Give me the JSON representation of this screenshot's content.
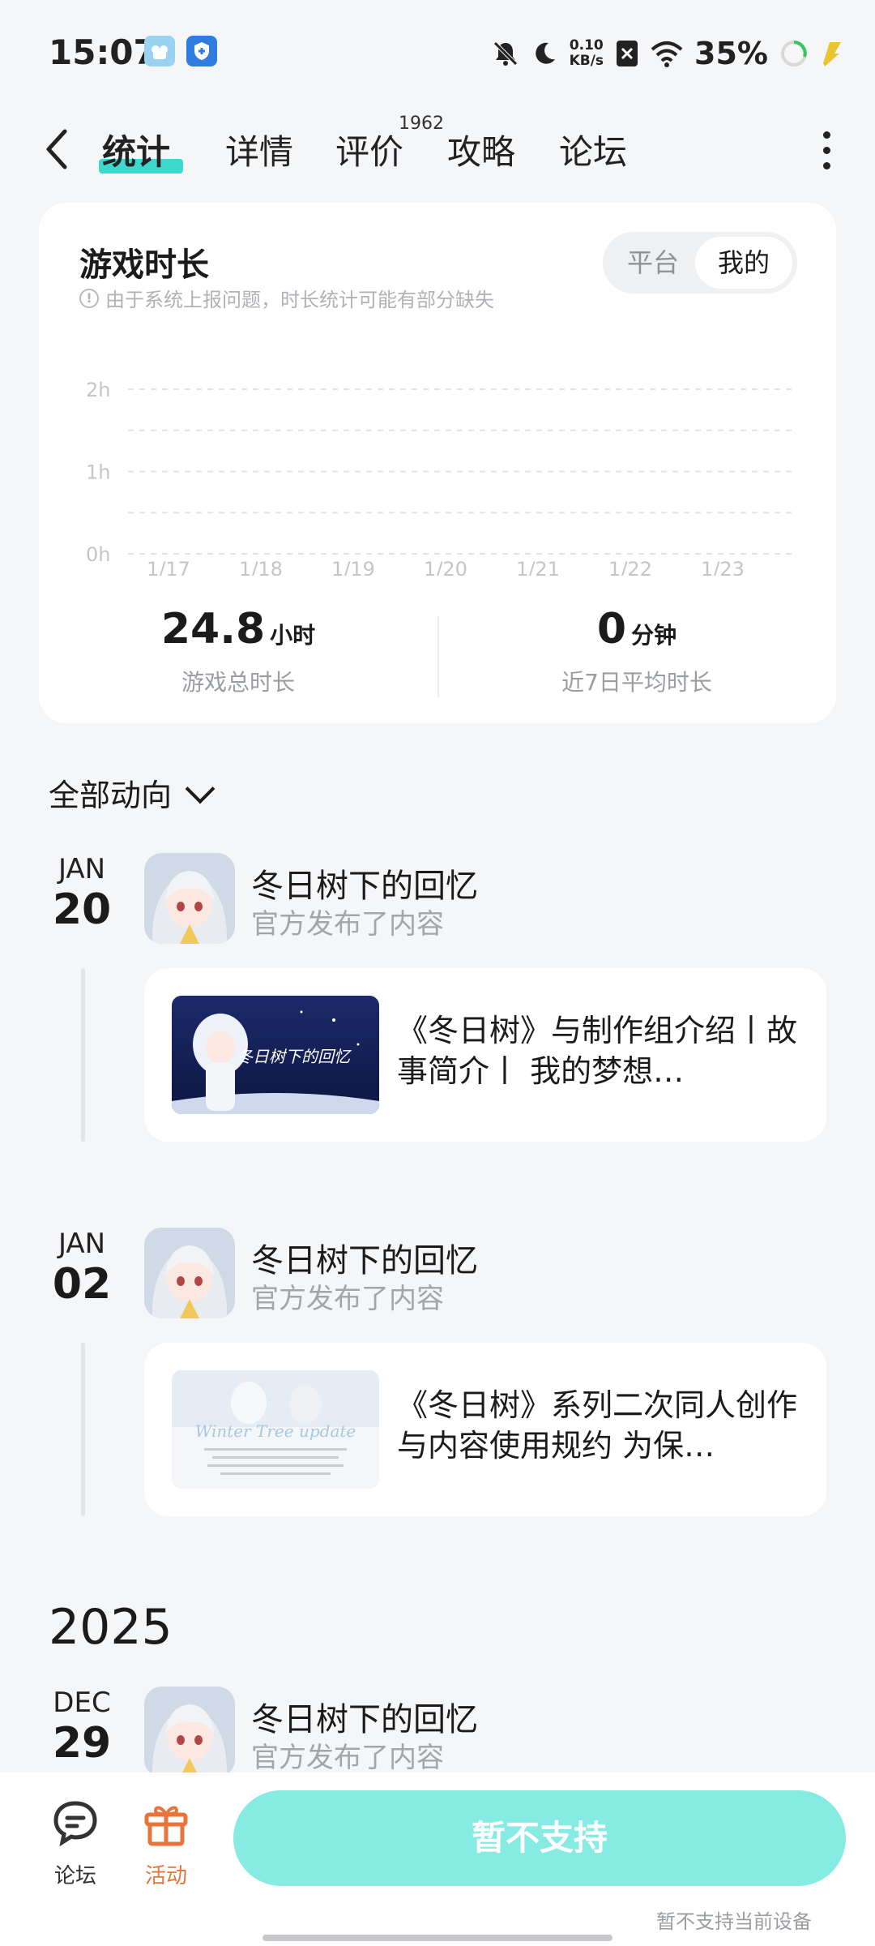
{
  "status_bar": {
    "time": "15:07",
    "net_speed_value": "0.10",
    "net_speed_unit": "KB/s",
    "battery": "35%",
    "icons": [
      "app-icon",
      "shield-icon",
      "bell-off-icon",
      "moon-icon",
      "sim-off-icon",
      "wifi-icon",
      "battery-ring-icon",
      "charging-icon"
    ]
  },
  "tabs": {
    "items": [
      "统计",
      "详情",
      "评价",
      "攻略",
      "论坛"
    ],
    "active": "统计",
    "review_count": "1962"
  },
  "stats_card": {
    "title": "游戏时长",
    "note": "由于系统上报问题，时长统计可能有部分缺失",
    "toggle": {
      "option_platform": "平台",
      "option_mine": "我的",
      "selected": "我的"
    },
    "total_value": "24.8",
    "total_unit": "小时",
    "total_label": "游戏总时长",
    "avg_value": "0",
    "avg_unit": "分钟",
    "avg_label": "近7日平均时长"
  },
  "chart_data": {
    "type": "bar",
    "categories": [
      "1/17",
      "1/18",
      "1/19",
      "1/20",
      "1/21",
      "1/22",
      "1/23"
    ],
    "values": [
      0,
      0,
      0,
      0,
      0,
      0,
      0
    ],
    "y_ticks": [
      "2h",
      "1h",
      "0h"
    ],
    "ylim": [
      0,
      2
    ],
    "grid": true
  },
  "feed": {
    "filter_label": "全部动向",
    "entries": [
      {
        "month": "JAN",
        "day": "20",
        "game": "冬日树下的回忆",
        "action": "官方发布了内容",
        "post_title": "《冬日树》与制作组介绍丨故事简介丨 我的梦想…"
      },
      {
        "month": "JAN",
        "day": "02",
        "game": "冬日树下的回忆",
        "action": "官方发布了内容",
        "post_title": "《冬日树》系列二次同人创作与内容使用规约 为保…"
      }
    ],
    "year_header": "2025",
    "year_entry": {
      "month": "DEC",
      "day": "29",
      "game": "冬日树下的回忆",
      "action": "官方发布了内容"
    },
    "thumb1_text": "冬日树下的回忆",
    "thumb2_text": "Winter Tree update"
  },
  "bottom_bar": {
    "forum_label": "论坛",
    "activity_label": "活动",
    "cta_label": "暂不支持",
    "cta_note": "暂不支持当前设备",
    "accent_color": "#e8743b",
    "cta_color": "#86ebe2"
  }
}
